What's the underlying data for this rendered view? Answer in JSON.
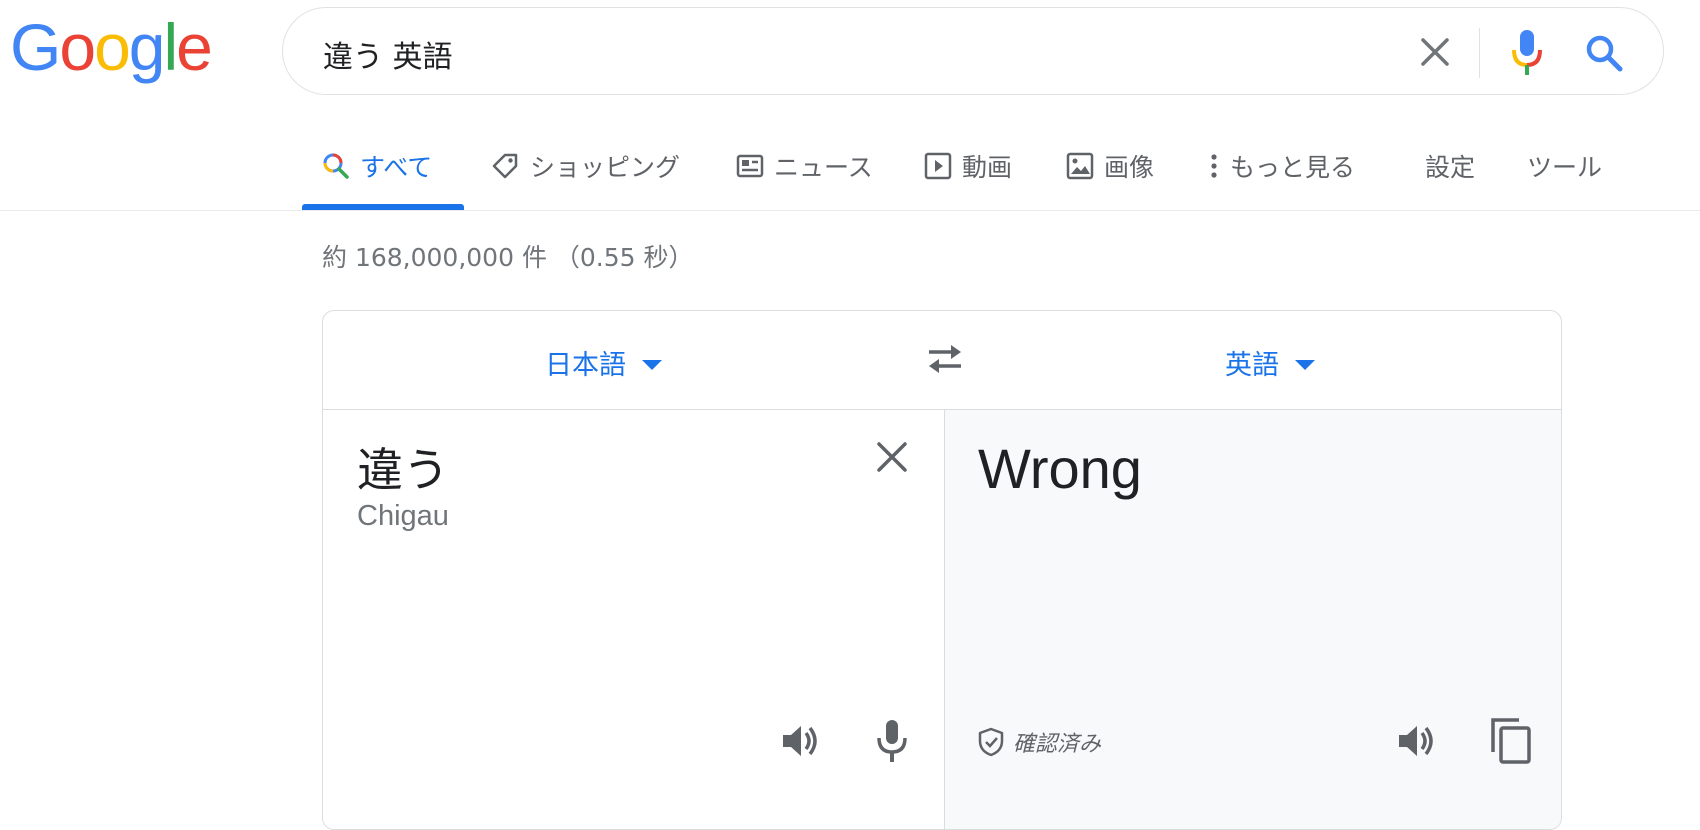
{
  "logo": {
    "letters": [
      "G",
      "o",
      "o",
      "g",
      "l",
      "e"
    ],
    "colors": [
      "#4285f4",
      "#ea4335",
      "#fbbc05",
      "#4285f4",
      "#34a853",
      "#ea4335"
    ]
  },
  "search": {
    "query": "違う 英語"
  },
  "tabs": {
    "all": "すべて",
    "shopping": "ショッピング",
    "news": "ニュース",
    "videos": "動画",
    "images": "画像",
    "more": "もっと見る",
    "settings": "設定",
    "tools": "ツール"
  },
  "result_stats": "約 168,000,000 件 （0.55 秒）",
  "translate": {
    "source_lang": "日本語",
    "target_lang": "英語",
    "source_text": "違う",
    "source_romaji": "Chigau",
    "target_text": "Wrong",
    "verified_label": "確認済み"
  },
  "colors": {
    "accent": "#1a73e8",
    "text": "#202124",
    "muted": "#70757a",
    "border": "#dadce0"
  }
}
